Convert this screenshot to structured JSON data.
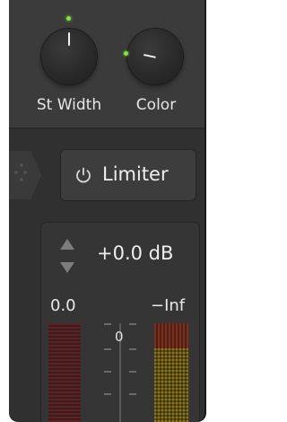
{
  "knobs": {
    "st_width": {
      "label": "St Width"
    },
    "color": {
      "label": "Color"
    }
  },
  "limiter": {
    "label": "Limiter"
  },
  "gain": {
    "value": "+0.0 dB"
  },
  "meter": {
    "left_value": "0.0",
    "right_value": "−Inf",
    "scale_zero": "0"
  },
  "colors": {
    "indicator_green": "#7ce83a",
    "panel_bg": "#303030",
    "meter_red": "#5a2424",
    "meter_yellow": "#8f781c"
  },
  "icons": [
    "power-icon",
    "stepper-icon"
  ]
}
